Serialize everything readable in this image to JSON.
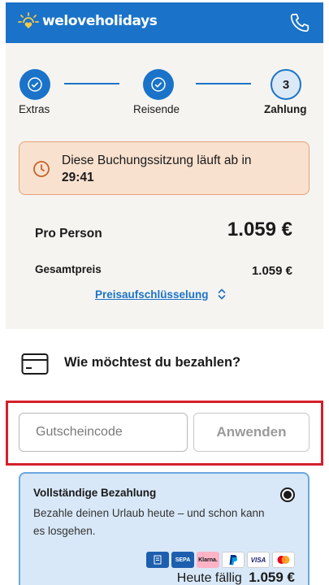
{
  "header": {
    "brand": "weloveholidays",
    "brand_icon": "sun-heart-logo",
    "phone_icon": "phone-icon",
    "bg_color": "#1a73c8"
  },
  "stepper": {
    "steps": [
      {
        "label": "Extras",
        "state": "done"
      },
      {
        "label": "Reisende",
        "state": "done"
      },
      {
        "label": "Zahlung",
        "state": "current",
        "number": "3"
      }
    ]
  },
  "timer": {
    "text": "Diese Buchungssitzung läuft ab in",
    "time": "29:41",
    "icon": "clock-icon"
  },
  "price": {
    "per_person_label": "Pro Person",
    "per_person_value": "1.059 €",
    "total_label": "Gesamtpreis",
    "total_value": "1.059 €",
    "breakdown_link": "Preisaufschlüsselung"
  },
  "payment": {
    "title": "Wie möchtest du bezahlen?",
    "voucher_placeholder": "Gutscheincode",
    "voucher_value": "",
    "apply_label": "Anwenden",
    "option": {
      "title": "Vollständige Bezahlung",
      "description": "Bezahle deinen Urlaub heute – und schon kann es losgehen.",
      "selected": true,
      "methods": [
        {
          "name": "Rechnung",
          "short": "Rechnung"
        },
        {
          "name": "SEPA Lastschrift",
          "short": "SEPA"
        },
        {
          "name": "Klarna",
          "short": "Klarna."
        },
        {
          "name": "PayPal",
          "short": "P"
        },
        {
          "name": "Visa",
          "short": "VISA"
        },
        {
          "name": "Mastercard",
          "short": ""
        }
      ],
      "due_label": "Heute fällig",
      "due_value": "1.059 €"
    }
  }
}
